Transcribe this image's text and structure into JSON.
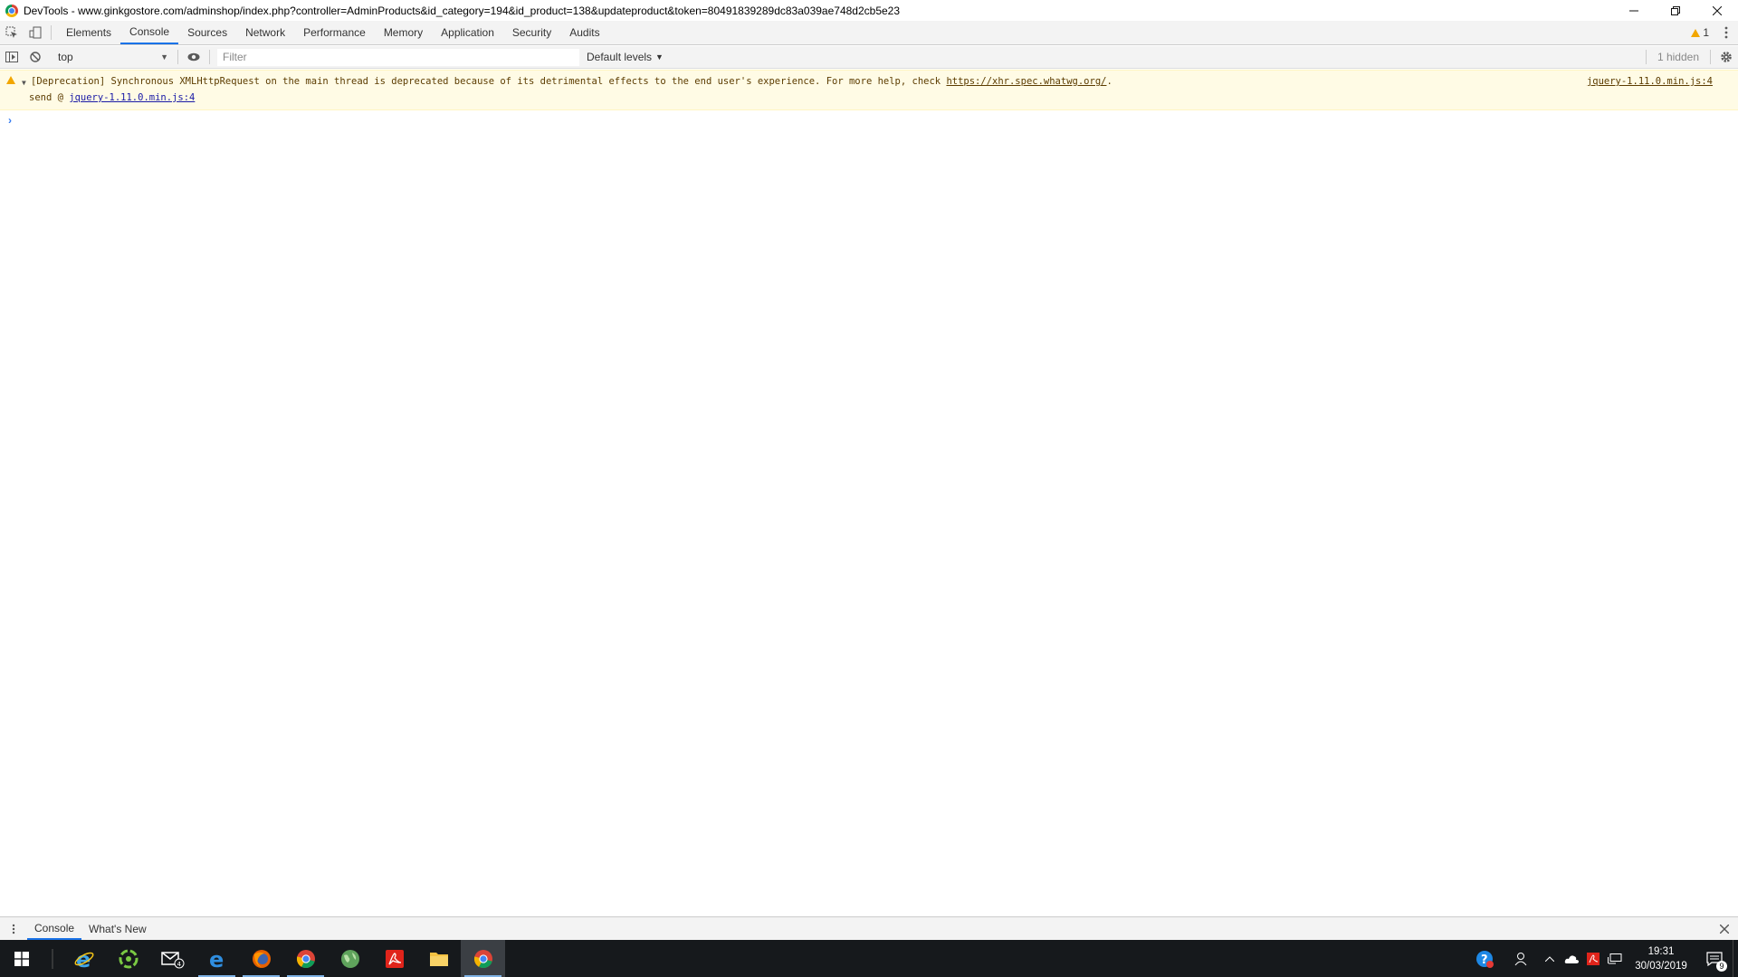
{
  "window": {
    "title": "DevTools - www.ginkgostore.com/adminshop/index.php?controller=AdminProducts&id_category=194&id_product=138&updateproduct&token=80491839289dc83a039ae748d2cb5e23",
    "controls": [
      "minimize",
      "restore",
      "close"
    ]
  },
  "tabs": [
    {
      "label": "Elements"
    },
    {
      "label": "Console"
    },
    {
      "label": "Sources"
    },
    {
      "label": "Network"
    },
    {
      "label": "Performance"
    },
    {
      "label": "Memory"
    },
    {
      "label": "Application"
    },
    {
      "label": "Security"
    },
    {
      "label": "Audits"
    }
  ],
  "active_tab": "Console",
  "warnings_count": "1",
  "toolbar": {
    "context": "top",
    "filter_placeholder": "Filter",
    "levels": "Default levels",
    "hidden": "1 hidden"
  },
  "messages": [
    {
      "level": "warning",
      "text": "[Deprecation] Synchronous XMLHttpRequest on the main thread is deprecated because of its detrimental effects to the end user's experience. For more help, check ",
      "link": "https://xhr.spec.whatwg.org/",
      "trailing": ".",
      "source": "jquery-1.11.0.min.js:4",
      "stack_prefix": "send @ ",
      "stack_link": "jquery-1.11.0.min.js:4"
    }
  ],
  "prompt_symbol": "›",
  "drawer": {
    "tabs": [
      {
        "label": "Console"
      },
      {
        "label": "What's New"
      }
    ]
  },
  "taskbar": {
    "apps": [
      "internet-explorer",
      "recycle-app",
      "mail",
      "edge",
      "firefox",
      "chrome",
      "earth-app",
      "acrobat-reader",
      "file-explorer",
      "chrome-active"
    ],
    "mail_badge": "4",
    "time": "19:31",
    "date": "30/03/2019",
    "notification_count": "9"
  }
}
